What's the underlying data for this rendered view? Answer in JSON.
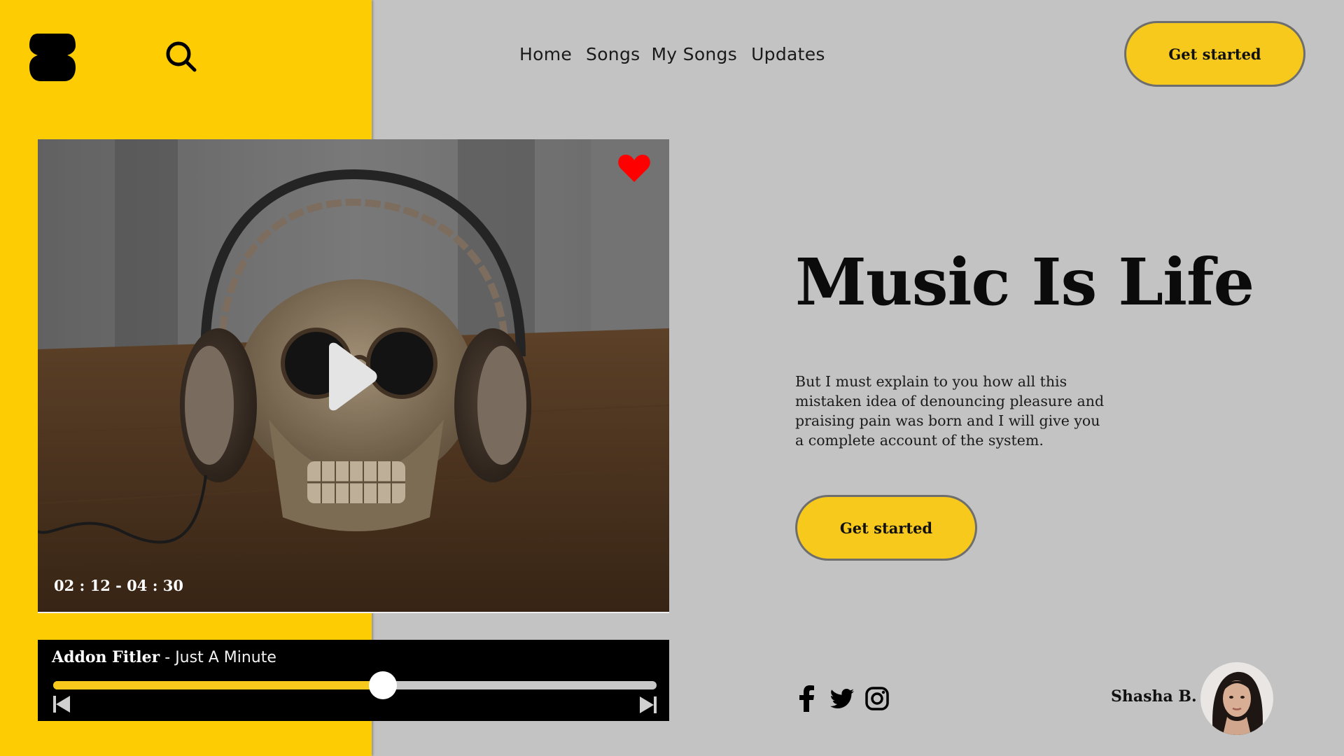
{
  "header": {
    "logo_icon": "app-logo-icon",
    "search_icon": "search-icon",
    "nav": [
      {
        "label": "Home"
      },
      {
        "label": "Songs"
      },
      {
        "label": "My Songs"
      },
      {
        "label": "Updates"
      }
    ],
    "cta_label": "Get started"
  },
  "player": {
    "favorite_icon": "heart-icon",
    "play_icon": "play-icon",
    "time": "02 : 12 - 04 : 30",
    "artist": "Addon Fitler",
    "separator": " - ",
    "song": "Just A Minute",
    "progress": 0.546,
    "prev_icon": "skip-previous-icon",
    "next_icon": "skip-next-icon"
  },
  "hero": {
    "title": "Music Is Life",
    "body": "But I must explain to you how all this mistaken idea of denouncing pleasure and praising pain was born and I will give you a complete account of the system.",
    "cta_label": "Get started"
  },
  "social": [
    {
      "icon": "facebook-icon"
    },
    {
      "icon": "twitter-icon"
    },
    {
      "icon": "instagram-icon"
    }
  ],
  "user": {
    "name": "Shasha B."
  },
  "colors": {
    "accent_yellow": "#fecc02",
    "button_yellow": "#f6c91c",
    "background_gray": "#c3c3c3",
    "heart_red": "#ff0000",
    "player_black": "#000000"
  }
}
